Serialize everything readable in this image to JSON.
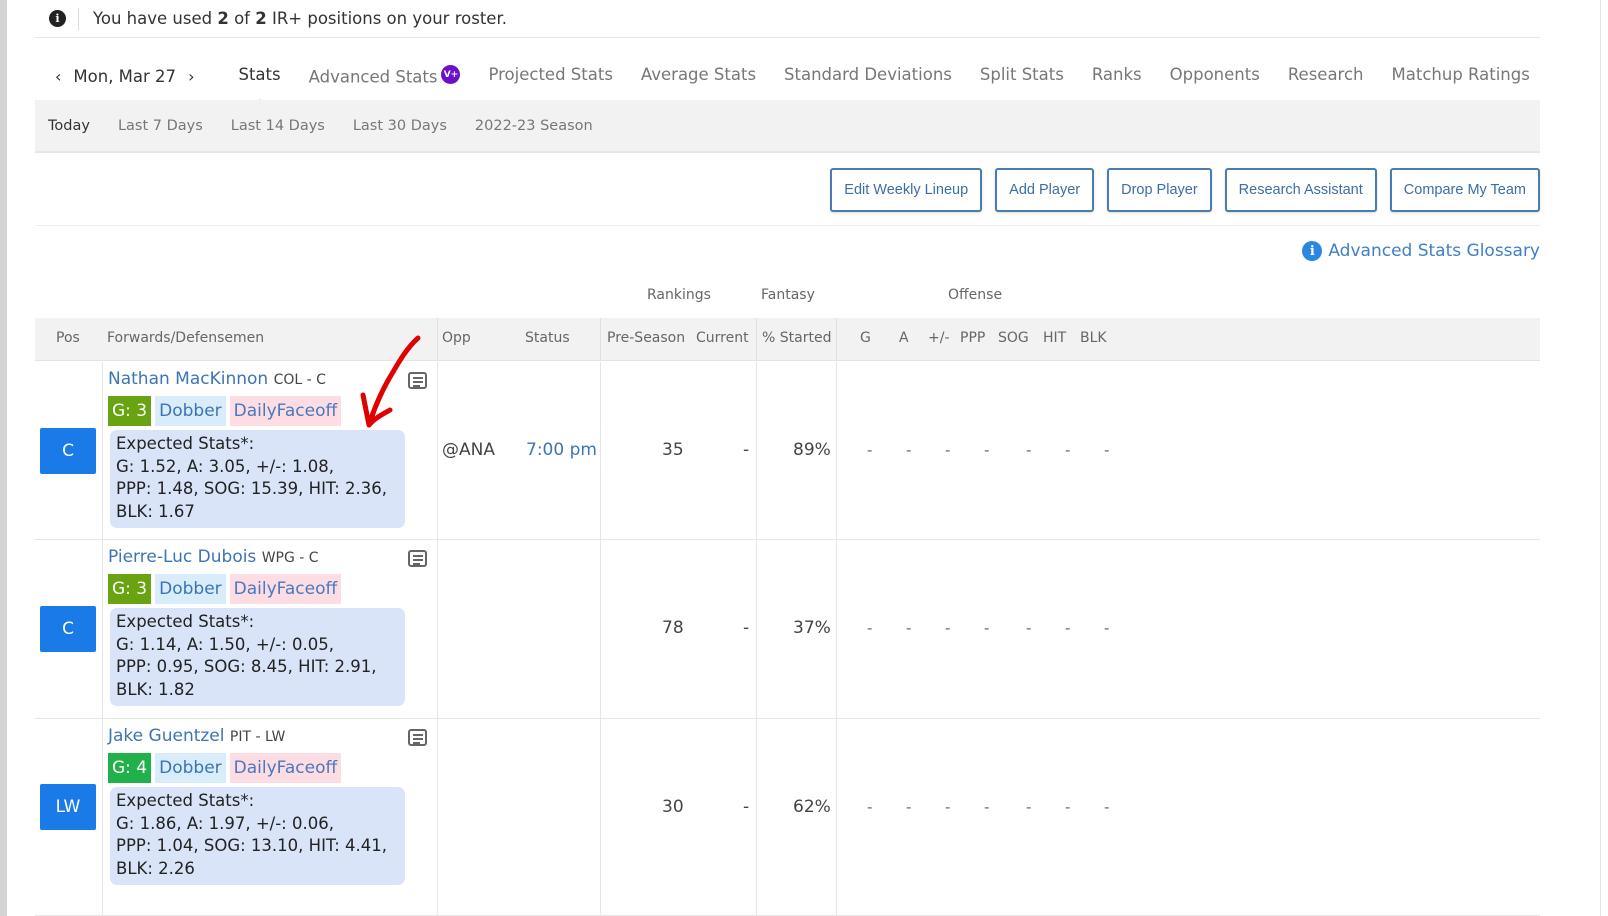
{
  "notice": {
    "prefix": "You have used ",
    "used": "2",
    "middle": " of ",
    "total": "2",
    "suffix": " IR+ positions on your roster."
  },
  "date_nav": {
    "date": "Mon, Mar 27",
    "prev_icon": "chevron-left-icon",
    "next_icon": "chevron-right-icon"
  },
  "tabs": [
    {
      "label": "Stats",
      "active": true
    },
    {
      "label": "Advanced Stats",
      "badge": "V+"
    },
    {
      "label": "Projected Stats"
    },
    {
      "label": "Average Stats"
    },
    {
      "label": "Standard Deviations"
    },
    {
      "label": "Split Stats"
    },
    {
      "label": "Ranks"
    },
    {
      "label": "Opponents"
    },
    {
      "label": "Research"
    },
    {
      "label": "Matchup Ratings"
    }
  ],
  "subtabs": [
    {
      "label": "Today",
      "active": true
    },
    {
      "label": "Last 7 Days"
    },
    {
      "label": "Last 14 Days"
    },
    {
      "label": "Last 30 Days"
    },
    {
      "label": "2022-23 Season"
    }
  ],
  "actions": [
    "Edit Weekly Lineup",
    "Add Player",
    "Drop Player",
    "Research Assistant",
    "Compare My Team"
  ],
  "glossary": {
    "label": "Advanced Stats Glossary",
    "icon": "info-icon"
  },
  "group_headers": {
    "rankings": "Rankings",
    "fantasy": "Fantasy",
    "offense": "Offense"
  },
  "columns": {
    "pos": "Pos",
    "player": "Forwards/Defensemen",
    "opp": "Opp",
    "status": "Status",
    "preseason": "Pre-Season",
    "current": "Current",
    "started": "% Started",
    "g": "G",
    "a": "A",
    "pm": "+/-",
    "ppp": "PPP",
    "sog": "SOG",
    "hit": "HIT",
    "blk": "BLK"
  },
  "players": [
    {
      "pos": "C",
      "name": "Nathan MacKinnon",
      "team_pos": "COL - C",
      "games": "G: 3",
      "games_color": "#6aa312",
      "dobber": "Dobber",
      "dailyfaceoff": "DailyFaceoff",
      "expected_title": "Expected Stats*:",
      "expected_line1": "G: 1.52, A: 3.05, +/-: 1.08,",
      "expected_line2": "PPP: 1.48, SOG: 15.39, HIT: 2.36,",
      "expected_line3": "BLK: 1.67",
      "opp": "@ANA",
      "status": "7:00 pm",
      "preseason": "35",
      "current": "-",
      "started": "89%",
      "stats": [
        "-",
        "-",
        "-",
        "-",
        "-",
        "-",
        "-"
      ]
    },
    {
      "pos": "C",
      "name": "Pierre-Luc Dubois",
      "team_pos": "WPG - C",
      "games": "G: 3",
      "games_color": "#6aa312",
      "dobber": "Dobber",
      "dailyfaceoff": "DailyFaceoff",
      "expected_title": "Expected Stats*:",
      "expected_line1": "G: 1.14, A: 1.50, +/-: 0.05,",
      "expected_line2": "PPP: 0.95, SOG: 8.45, HIT: 2.91,",
      "expected_line3": "BLK: 1.82",
      "opp": "",
      "status": "",
      "preseason": "78",
      "current": "-",
      "started": "37%",
      "stats": [
        "-",
        "-",
        "-",
        "-",
        "-",
        "-",
        "-"
      ]
    },
    {
      "pos": "LW",
      "name": "Jake Guentzel",
      "team_pos": "PIT - LW",
      "games": "G: 4",
      "games_color": "#21b14a",
      "dobber": "Dobber",
      "dailyfaceoff": "DailyFaceoff",
      "expected_title": "Expected Stats*:",
      "expected_line1": "G: 1.86, A: 1.97, +/-: 0.06,",
      "expected_line2": "PPP: 1.04, SOG: 13.10, HIT: 4.41,",
      "expected_line3": "BLK: 2.26",
      "opp": "",
      "status": "",
      "preseason": "30",
      "current": "-",
      "started": "62%",
      "stats": [
        "-",
        "-",
        "-",
        "-",
        "-",
        "-",
        "-"
      ]
    }
  ],
  "colors": {
    "accent_blue": "#1a7ae8",
    "link_blue": "#3b75b5",
    "vplus_purple": "#6b12c9",
    "annotation_red": "#e00000"
  }
}
